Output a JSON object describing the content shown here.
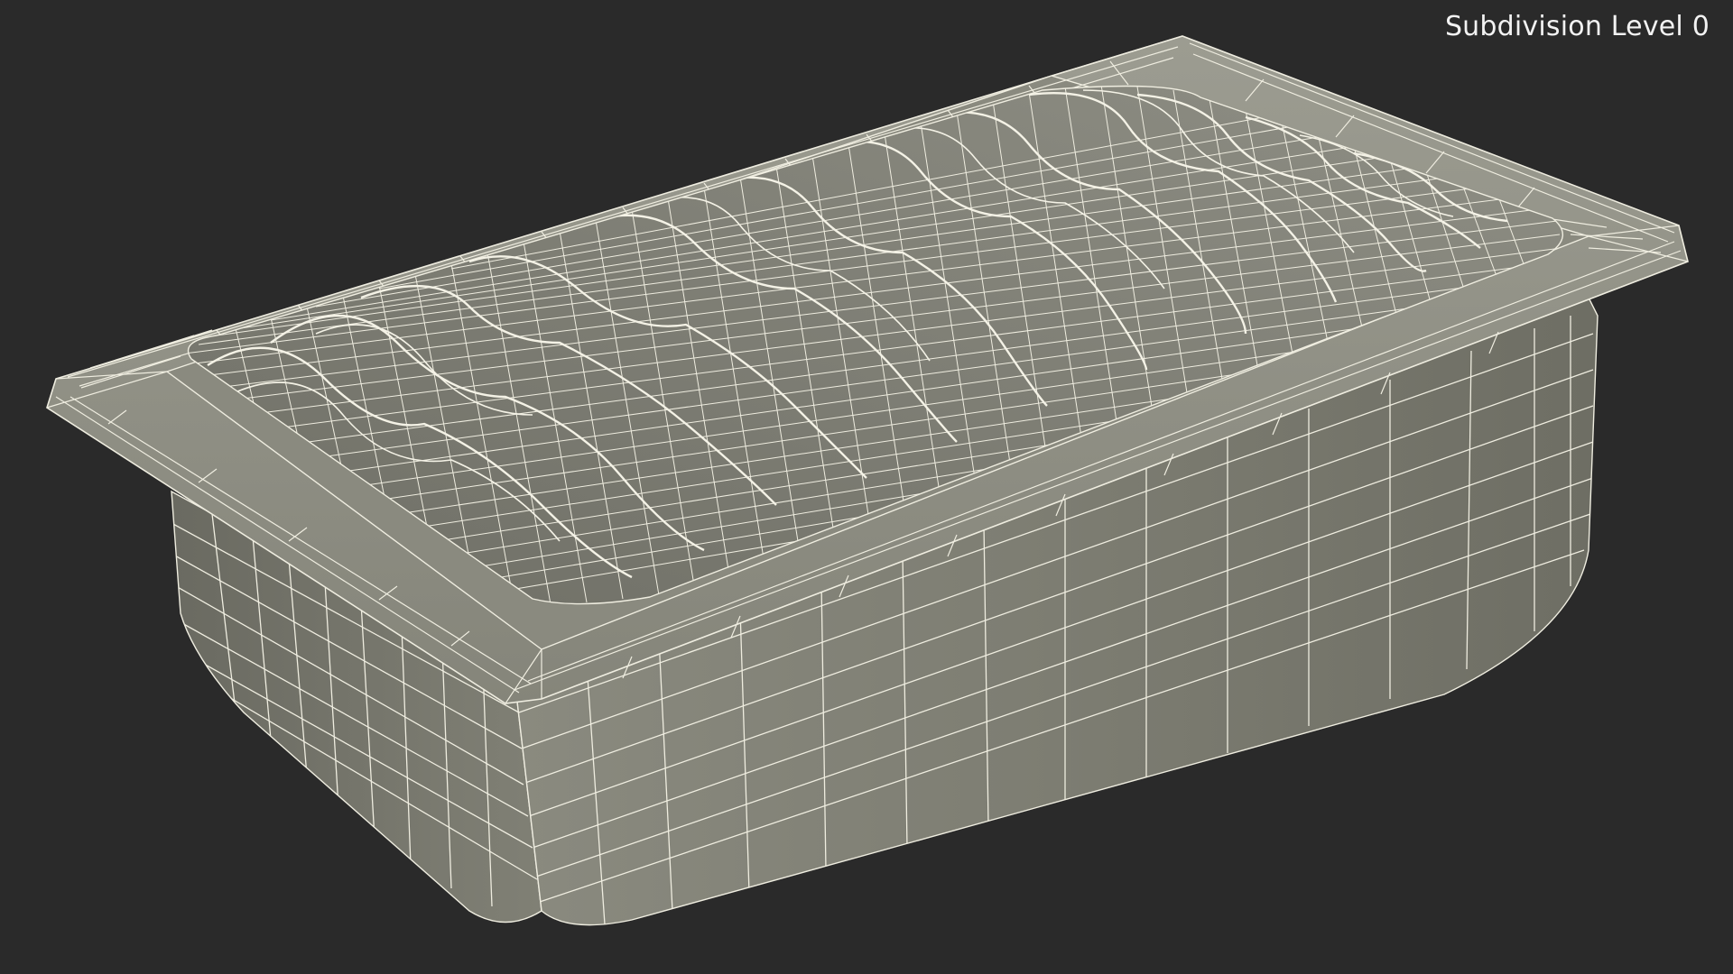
{
  "viewport": {
    "label": "Subdivision Level 0",
    "background_color": "#2a2a2a"
  },
  "model": {
    "object": "rectangular tray with wavy filling",
    "render_mode": "wireframe-on-shaded",
    "surface_color": "#7b7b70",
    "wire_color": "#efede0"
  }
}
